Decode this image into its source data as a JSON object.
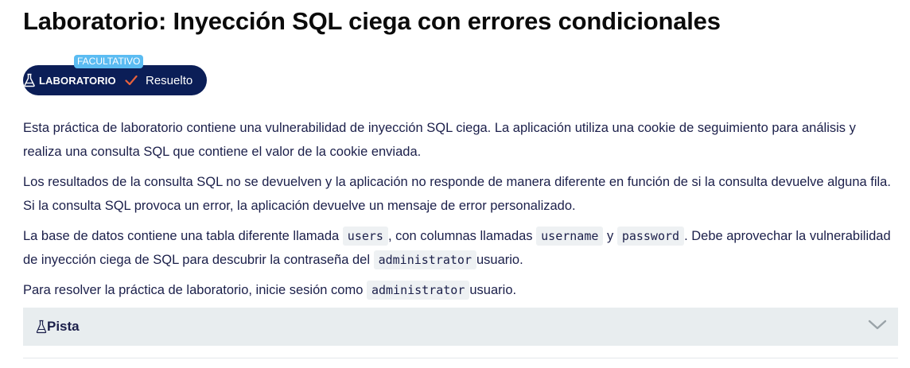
{
  "title": "Laboratorio: Inyección SQL ciega con errores condicionales",
  "badge": {
    "optional_label": "FACULTATIVO",
    "lab_label": "LABORATORIO",
    "solved_label": "Resuelto",
    "colors": {
      "badge_bg": "#0b1e57",
      "optional_bg": "#5bbcf2",
      "check": "#e8613c"
    },
    "icons": [
      "flask-icon",
      "check-icon"
    ]
  },
  "description": {
    "p1": "Esta práctica de laboratorio contiene una vulnerabilidad de inyección SQL ciega. La aplicación utiliza una cookie de seguimiento para análisis y realiza una consulta SQL que contiene el valor de la cookie enviada.",
    "p2": "Los resultados de la consulta SQL no se devuelven y la aplicación no responde de manera diferente en función de si la consulta devuelve alguna fila. Si la consulta SQL provoca un error, la aplicación devuelve un mensaje de error personalizado.",
    "p3": {
      "t1": "La base de datos contiene una tabla diferente llamada ",
      "c1": "users",
      "t2": ", con columnas llamadas ",
      "c2": "username",
      "t3": " y ",
      "c3": "password",
      "t4": ". Debe aprovechar la vulnerabilidad de inyección ciega de SQL para descubrir la contraseña del ",
      "c4": "administrator",
      "t5": "usuario."
    },
    "p4": {
      "t1": "Para resolver la práctica de laboratorio, inicie sesión como ",
      "c1": "administrator",
      "t2": "usuario."
    }
  },
  "hint": {
    "label": "Pista",
    "icons": [
      "flask-icon",
      "chevron-down-icon"
    ]
  }
}
